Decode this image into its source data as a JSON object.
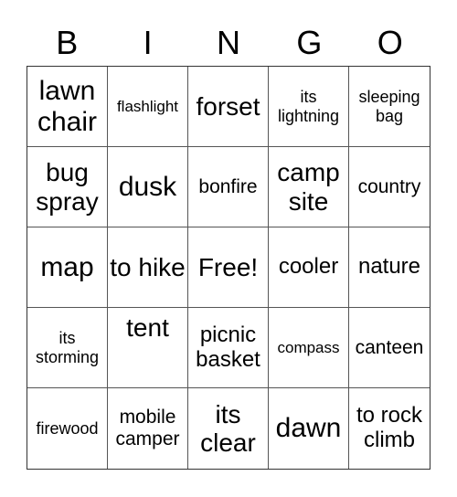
{
  "header": {
    "letters": [
      "B",
      "I",
      "N",
      "G",
      "O"
    ]
  },
  "board": {
    "rows": [
      [
        "lawn chair",
        "flashlight",
        "forset",
        "its lightning",
        "sleeping bag"
      ],
      [
        "bug spray",
        "dusk",
        "bonfire",
        "camp site",
        "country"
      ],
      [
        "map",
        "to hike",
        "Free!",
        "cooler",
        "nature"
      ],
      [
        "its storming",
        "tent",
        "picnic basket",
        "compass",
        "canteen"
      ],
      [
        "firewood",
        "mobile camper",
        "its clear",
        "dawn",
        "to rock climb"
      ]
    ],
    "free_space": "Free!"
  }
}
